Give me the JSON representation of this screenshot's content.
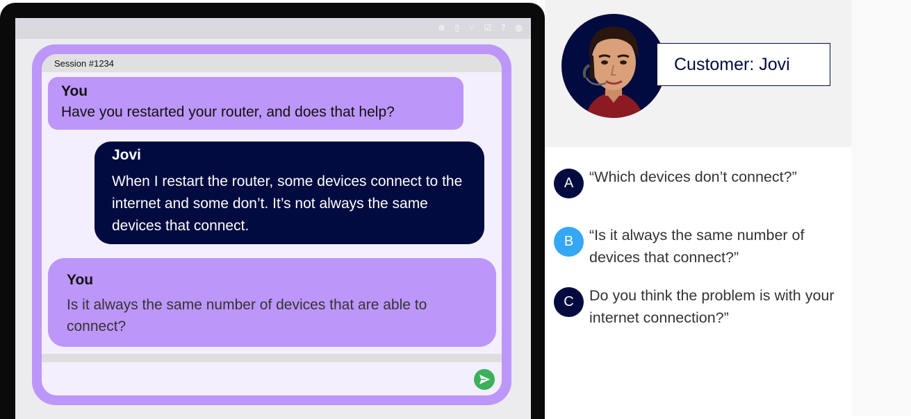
{
  "chat": {
    "session_label": "Session #1234",
    "messages": [
      {
        "sender": "You",
        "text": "Have you restarted your router, and does that help?"
      },
      {
        "sender": "Jovi",
        "text": "When I restart the router, some devices connect to the internet and some don’t. It’s not always the same devices that connect."
      },
      {
        "sender": "You",
        "text": "Is it always the same number of devices that are able to connect?"
      }
    ]
  },
  "customer": {
    "label": "Customer: Jovi"
  },
  "options": [
    {
      "letter": "A",
      "text": "“Which devices don’t connect?”",
      "color": "#020b3f"
    },
    {
      "letter": "B",
      "text": "“Is it always the same number of devices that connect?”",
      "color": "#35a7f5"
    },
    {
      "letter": "C",
      "text": "Do you think the problem is with your internet connection?”",
      "color": "#020b3f"
    }
  ],
  "colors": {
    "accent_purple": "#bd96fa",
    "navy": "#020b3f",
    "send_green": "#3cb15b"
  }
}
